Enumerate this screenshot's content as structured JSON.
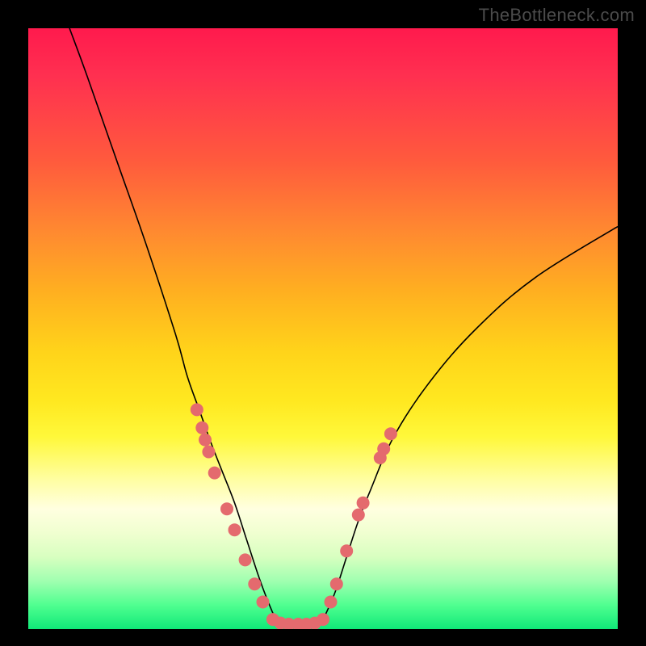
{
  "watermark": "TheBottleneck.com",
  "chart_data": {
    "type": "line",
    "title": "",
    "xlabel": "",
    "ylabel": "",
    "xlim": [
      0,
      100
    ],
    "ylim": [
      0,
      100
    ],
    "series": [
      {
        "name": "left-curve",
        "x": [
          7,
          10,
          15,
          20,
          25,
          27,
          29,
          31,
          33,
          35,
          37,
          39,
          40.5,
          42
        ],
        "y": [
          100,
          92,
          78,
          64,
          49,
          42,
          36.5,
          31,
          26,
          21,
          15,
          9,
          5,
          1.5
        ]
      },
      {
        "name": "valley-floor",
        "x": [
          42,
          44,
          46,
          48,
          50
        ],
        "y": [
          1.5,
          0.7,
          0.7,
          0.7,
          1.5
        ]
      },
      {
        "name": "right-curve",
        "x": [
          50,
          52,
          54,
          56,
          58,
          62,
          68,
          76,
          86,
          100
        ],
        "y": [
          1.5,
          6,
          12,
          18,
          23,
          32,
          41,
          50,
          58.5,
          67
        ]
      }
    ],
    "markers": [
      {
        "series": "left-cluster",
        "x": 28.6,
        "y": 36.5
      },
      {
        "series": "left-cluster",
        "x": 29.5,
        "y": 33.5
      },
      {
        "series": "left-cluster",
        "x": 30.0,
        "y": 31.5
      },
      {
        "series": "left-cluster",
        "x": 30.6,
        "y": 29.5
      },
      {
        "series": "left-cluster",
        "x": 31.6,
        "y": 26.0
      },
      {
        "series": "left-cluster",
        "x": 33.7,
        "y": 20.0
      },
      {
        "series": "left-cluster",
        "x": 35.0,
        "y": 16.5
      },
      {
        "series": "left-cluster",
        "x": 36.8,
        "y": 11.5
      },
      {
        "series": "left-cluster",
        "x": 38.4,
        "y": 7.5
      },
      {
        "series": "left-cluster",
        "x": 39.8,
        "y": 4.5
      },
      {
        "series": "floor",
        "x": 41.5,
        "y": 1.6
      },
      {
        "series": "floor",
        "x": 42.8,
        "y": 1.0
      },
      {
        "series": "floor",
        "x": 44.2,
        "y": 0.8
      },
      {
        "series": "floor",
        "x": 45.8,
        "y": 0.8
      },
      {
        "series": "floor",
        "x": 47.2,
        "y": 0.8
      },
      {
        "series": "floor",
        "x": 48.6,
        "y": 1.0
      },
      {
        "series": "floor",
        "x": 50.0,
        "y": 1.6
      },
      {
        "series": "right-cluster",
        "x": 51.3,
        "y": 4.5
      },
      {
        "series": "right-cluster",
        "x": 52.3,
        "y": 7.5
      },
      {
        "series": "right-cluster",
        "x": 54.0,
        "y": 13.0
      },
      {
        "series": "right-cluster",
        "x": 56.0,
        "y": 19.0
      },
      {
        "series": "right-cluster",
        "x": 56.8,
        "y": 21.0
      },
      {
        "series": "right-cluster",
        "x": 59.7,
        "y": 28.5
      },
      {
        "series": "right-cluster",
        "x": 60.3,
        "y": 30.0
      },
      {
        "series": "right-cluster",
        "x": 61.5,
        "y": 32.5
      }
    ]
  }
}
